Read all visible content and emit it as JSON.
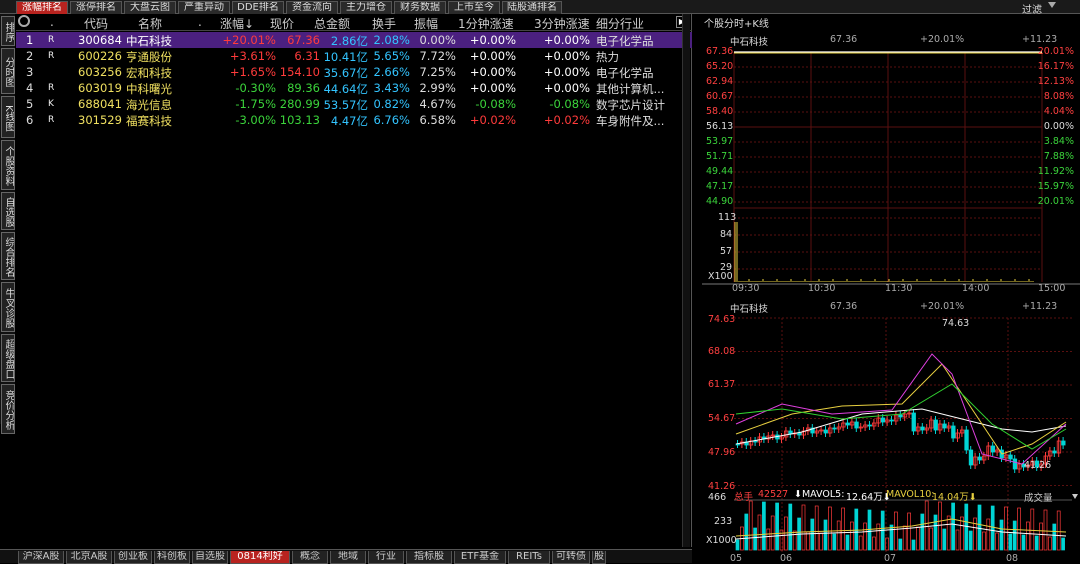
{
  "top_tabs": [
    "涨幅排名",
    "涨停排名",
    "大盘云图",
    "严重异动",
    "DDE排名",
    "资金流向",
    "主力增仓",
    "财务数据",
    "上市至今",
    "陆股通排名"
  ],
  "filter_label": "过滤",
  "left_nav": [
    "排序",
    "分时图",
    "K线图",
    "个股资料",
    "自选股",
    "综合排名",
    "牛叉诊股",
    "超级盘口",
    "竞价分析"
  ],
  "table": {
    "headers": [
      ".",
      "代码",
      "名称",
      ".",
      "涨幅",
      "现价",
      "总金额",
      "换手",
      "振幅",
      "1分钟涨速",
      "3分钟涨速",
      "细分行业"
    ],
    "sort_arrow": "↓",
    "rows": [
      {
        "idx": "1",
        "flag": "R",
        "code": "300684",
        "name": "中石科技",
        "chg": "+20.01%",
        "price": "67.36",
        "amount": "2.86亿",
        "turnover": "2.08%",
        "amp": "0.00%",
        "s1": "+0.00%",
        "s3": "+0.00%",
        "ind": "电子化学品"
      },
      {
        "idx": "2",
        "flag": "R",
        "code": "600226",
        "name": "亨通股份",
        "chg": "+3.61%",
        "price": "6.31",
        "amount": "10.41亿",
        "turnover": "5.65%",
        "amp": "7.72%",
        "s1": "+0.00%",
        "s3": "+0.00%",
        "ind": "热力"
      },
      {
        "idx": "3",
        "flag": "",
        "code": "603256",
        "name": "宏和科技",
        "chg": "+1.65%",
        "price": "154.10",
        "amount": "35.67亿",
        "turnover": "2.66%",
        "amp": "7.25%",
        "s1": "+0.00%",
        "s3": "+0.00%",
        "ind": "电子化学品"
      },
      {
        "idx": "4",
        "flag": "R",
        "code": "603019",
        "name": "中科曙光",
        "chg": "-0.30%",
        "price": "89.36",
        "amount": "44.64亿",
        "turnover": "3.43%",
        "amp": "2.99%",
        "s1": "+0.00%",
        "s3": "+0.00%",
        "ind": "其他计算机..."
      },
      {
        "idx": "5",
        "flag": "K",
        "code": "688041",
        "name": "海光信息",
        "chg": "-1.75%",
        "price": "280.99",
        "amount": "53.57亿",
        "turnover": "0.82%",
        "amp": "4.67%",
        "s1": "-0.08%",
        "s3": "-0.08%",
        "ind": "数字芯片设计"
      },
      {
        "idx": "6",
        "flag": "R",
        "code": "301529",
        "name": "福赛科技",
        "chg": "-3.00%",
        "price": "103.13",
        "amount": "4.47亿",
        "turnover": "6.76%",
        "amp": "6.58%",
        "s1": "+0.02%",
        "s3": "+0.02%",
        "ind": "车身附件及..."
      }
    ]
  },
  "bottom_tabs": [
    "沪深A股",
    "北京A股",
    "创业板",
    "科创板",
    "自选股",
    "0814利好",
    "概念",
    "地域",
    "行业",
    "指标股",
    "ETF基金",
    "REITs",
    "可转债",
    "股"
  ],
  "right": {
    "panel_title": "个股分时+K线",
    "intraday": {
      "stock": "中石科技",
      "price": "67.36",
      "pct": "+20.01%",
      "chg": "+11.23",
      "prices": [
        "67.36",
        "65.20",
        "62.94",
        "60.67",
        "58.40",
        "56.13",
        "53.97",
        "51.71",
        "49.44",
        "47.17",
        "44.90"
      ],
      "pcts": [
        "20.01%",
        "16.17%",
        "12.13%",
        "8.08%",
        "4.04%",
        "0.00%",
        "3.84%",
        "7.88%",
        "11.92%",
        "15.97%",
        "20.01%"
      ],
      "vol_labels": [
        "113",
        "84",
        "57",
        "29"
      ],
      "vol_unit": "X100",
      "times": [
        "09:30",
        "10:30",
        "11:30",
        "14:00",
        "15:00"
      ]
    },
    "kline": {
      "stock": "中石科技",
      "price": "67.36",
      "pct": "+20.01%",
      "chg": "+11.23",
      "prices": [
        "74.63",
        "68.08",
        "61.37",
        "54.67",
        "47.96",
        "41.26"
      ],
      "high_label": "74.63",
      "low_label": "41.26",
      "vol_text_label": "总手",
      "vol_text_value": "42527",
      "ma5_label": "MAVOL5:",
      "ma5_value": "12.64万",
      "ma10_label": "MAVOL10:",
      "ma10_value": "14.04万",
      "indicator": "成交量",
      "vol_ticks": [
        "466",
        "233"
      ],
      "vol_unit": "X1000",
      "months": [
        "05",
        "06",
        "07",
        "08"
      ]
    }
  }
}
